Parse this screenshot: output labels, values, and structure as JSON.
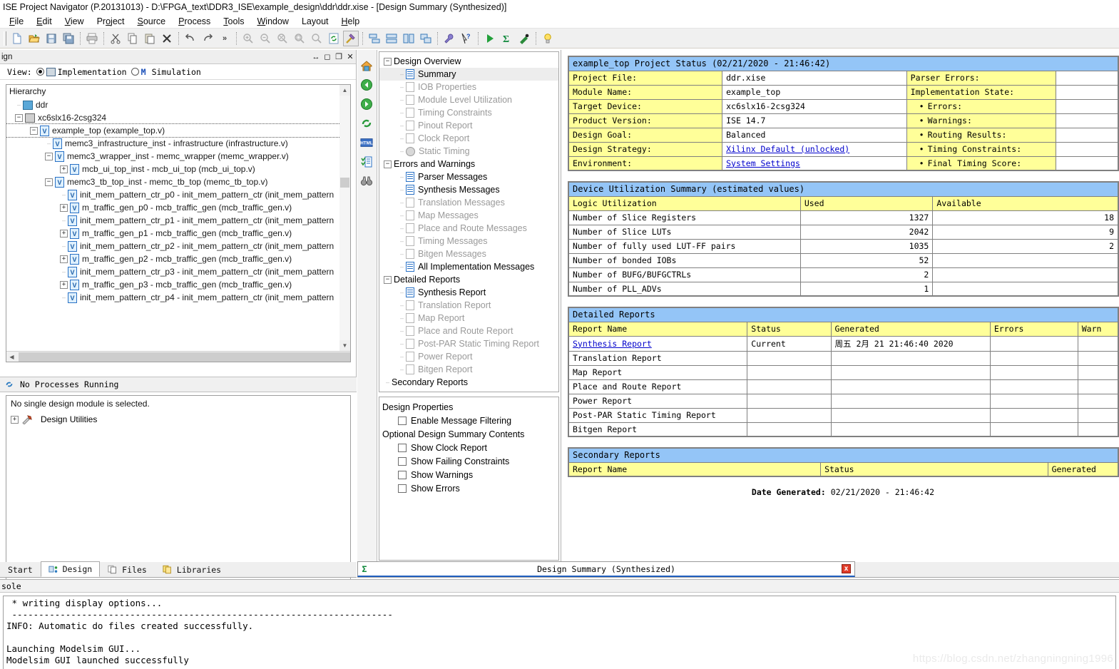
{
  "window": {
    "title": "ISE Project Navigator (P.20131013) - D:\\FPGA_text\\DDR3_ISE\\example_design\\ddr\\ddr.xise - [Design Summary (Synthesized)]"
  },
  "menu": [
    {
      "label": "File",
      "accel": "F"
    },
    {
      "label": "Edit",
      "accel": "E"
    },
    {
      "label": "View",
      "accel": "V"
    },
    {
      "label": "Project",
      "accel": "o"
    },
    {
      "label": "Source",
      "accel": "S"
    },
    {
      "label": "Process",
      "accel": "P"
    },
    {
      "label": "Tools",
      "accel": "T"
    },
    {
      "label": "Window",
      "accel": "W"
    },
    {
      "label": "Layout",
      "accel": ""
    },
    {
      "label": "Help",
      "accel": "H"
    }
  ],
  "toolbar": {
    "groups": [
      [
        "new-file-icon",
        "open-project-icon",
        "save-icon",
        "save-all-icon"
      ],
      [
        "print-icon"
      ],
      [
        "cut-icon",
        "copy-icon",
        "paste-icon",
        "delete-icon",
        "undo-icon",
        "redo-icon",
        "overflow-chevron-icon"
      ],
      [
        "zoom-in-icon",
        "zoom-out-icon",
        "zoom-fit-icon",
        "zoom-selection-icon",
        "zoom-area-icon",
        "refresh-icon",
        "implement-hammer-icon"
      ],
      [
        "tile-horizontally-icon",
        "tile-vertically-icon",
        "new-window-icon",
        "cascade-icon"
      ],
      [
        "options-wrench-icon",
        "whats-this-help-icon"
      ],
      [
        "run-icon",
        "design-summary-sigma-icon",
        "design-goals-icon"
      ],
      [
        "lightbulb-icon"
      ]
    ],
    "overflow_label": "»"
  },
  "design_panel": {
    "title": "ign",
    "controls": [
      "resize-icon",
      "maximize-icon",
      "float-icon",
      "close-icon"
    ],
    "view_label": "View:",
    "view_options": [
      {
        "label": "Implementation",
        "selected": true,
        "icon": "chip-icon"
      },
      {
        "label": "Simulation",
        "selected": false,
        "icon": "m-icon"
      }
    ],
    "hierarchy_label": "Hierarchy",
    "hierarchy": [
      {
        "depth": 0,
        "expander": "none",
        "icon": "project-icon",
        "label": "ddr"
      },
      {
        "depth": 0,
        "expander": "minus",
        "icon": "device-icon",
        "label": "xc6slx16-2csg324"
      },
      {
        "depth": 1,
        "expander": "minus",
        "icon": "verilog-top-icon",
        "label": "example_top (example_top.v)",
        "selected": true
      },
      {
        "depth": 2,
        "expander": "none",
        "icon": "verilog-icon",
        "label": "memc3_infrastructure_inst - infrastructure (infrastructure.v)"
      },
      {
        "depth": 2,
        "expander": "minus",
        "icon": "verilog-icon",
        "label": "memc3_wrapper_inst - memc_wrapper (memc_wrapper.v)"
      },
      {
        "depth": 3,
        "expander": "plus",
        "icon": "verilog-icon",
        "label": "mcb_ui_top_inst - mcb_ui_top (mcb_ui_top.v)"
      },
      {
        "depth": 2,
        "expander": "minus",
        "icon": "verilog-icon",
        "label": "memc3_tb_top_inst - memc_tb_top (memc_tb_top.v)"
      },
      {
        "depth": 3,
        "expander": "none",
        "icon": "verilog-icon",
        "label": "init_mem_pattern_ctr_p0 - init_mem_pattern_ctr (init_mem_pattern"
      },
      {
        "depth": 3,
        "expander": "plus",
        "icon": "verilog-icon",
        "label": "m_traffic_gen_p0 - mcb_traffic_gen (mcb_traffic_gen.v)"
      },
      {
        "depth": 3,
        "expander": "none",
        "icon": "verilog-icon",
        "label": "init_mem_pattern_ctr_p1 - init_mem_pattern_ctr (init_mem_pattern"
      },
      {
        "depth": 3,
        "expander": "plus",
        "icon": "verilog-icon",
        "label": "m_traffic_gen_p1 - mcb_traffic_gen (mcb_traffic_gen.v)"
      },
      {
        "depth": 3,
        "expander": "none",
        "icon": "verilog-icon",
        "label": "init_mem_pattern_ctr_p2 - init_mem_pattern_ctr (init_mem_pattern"
      },
      {
        "depth": 3,
        "expander": "plus",
        "icon": "verilog-icon",
        "label": "m_traffic_gen_p2 - mcb_traffic_gen (mcb_traffic_gen.v)"
      },
      {
        "depth": 3,
        "expander": "none",
        "icon": "verilog-icon",
        "label": "init_mem_pattern_ctr_p3 - init_mem_pattern_ctr (init_mem_pattern"
      },
      {
        "depth": 3,
        "expander": "plus",
        "icon": "verilog-icon",
        "label": "m_traffic_gen_p3 - mcb_traffic_gen (mcb_traffic_gen.v)"
      },
      {
        "depth": 3,
        "expander": "none",
        "icon": "verilog-icon",
        "label": "init_mem_pattern_ctr_p4 - init_mem_pattern_ctr (init_mem_pattern"
      }
    ]
  },
  "processes": {
    "header": "No Processes Running",
    "header_icon": "refresh-icon",
    "message": "No single design module is selected.",
    "items": [
      {
        "label": "Design Utilities",
        "expander": "plus",
        "icon": "utilities-icon"
      }
    ]
  },
  "left_tabs": [
    {
      "label": "Start",
      "icon": "",
      "active": false
    },
    {
      "label": "Design",
      "icon": "design-icon",
      "active": true
    },
    {
      "label": "Files",
      "icon": "files-icon",
      "active": false
    },
    {
      "label": "Libraries",
      "icon": "libraries-icon",
      "active": false
    }
  ],
  "icon_strip": [
    "home-icon",
    "back-arrow-icon",
    "forward-arrow-icon",
    "refresh-icon",
    "html-icon",
    "report-list-icon",
    "binoculars-icon"
  ],
  "overview_tree": [
    {
      "depth": 0,
      "expander": "minus",
      "icon": "",
      "label": "Design Overview",
      "state": "normal"
    },
    {
      "depth": 1,
      "expander": "none",
      "icon": "doc-active",
      "label": "Summary",
      "state": "selected"
    },
    {
      "depth": 1,
      "expander": "none",
      "icon": "doc",
      "label": "IOB Properties",
      "state": "disabled"
    },
    {
      "depth": 1,
      "expander": "none",
      "icon": "doc",
      "label": "Module Level Utilization",
      "state": "disabled"
    },
    {
      "depth": 1,
      "expander": "none",
      "icon": "doc",
      "label": "Timing Constraints",
      "state": "disabled"
    },
    {
      "depth": 1,
      "expander": "none",
      "icon": "doc",
      "label": "Pinout Report",
      "state": "disabled"
    },
    {
      "depth": 1,
      "expander": "none",
      "icon": "doc",
      "label": "Clock Report",
      "state": "disabled"
    },
    {
      "depth": 1,
      "expander": "none",
      "icon": "clock",
      "label": "Static Timing",
      "state": "disabled"
    },
    {
      "depth": 0,
      "expander": "minus",
      "icon": "",
      "label": "Errors and Warnings",
      "state": "normal"
    },
    {
      "depth": 1,
      "expander": "none",
      "icon": "doc-active",
      "label": "Parser Messages",
      "state": "normal"
    },
    {
      "depth": 1,
      "expander": "none",
      "icon": "doc-active",
      "label": "Synthesis Messages",
      "state": "normal"
    },
    {
      "depth": 1,
      "expander": "none",
      "icon": "doc",
      "label": "Translation Messages",
      "state": "disabled"
    },
    {
      "depth": 1,
      "expander": "none",
      "icon": "doc",
      "label": "Map Messages",
      "state": "disabled"
    },
    {
      "depth": 1,
      "expander": "none",
      "icon": "doc",
      "label": "Place and Route Messages",
      "state": "disabled"
    },
    {
      "depth": 1,
      "expander": "none",
      "icon": "doc",
      "label": "Timing Messages",
      "state": "disabled"
    },
    {
      "depth": 1,
      "expander": "none",
      "icon": "doc",
      "label": "Bitgen Messages",
      "state": "disabled"
    },
    {
      "depth": 1,
      "expander": "none",
      "icon": "doc-active",
      "label": "All Implementation Messages",
      "state": "normal"
    },
    {
      "depth": 0,
      "expander": "minus",
      "icon": "",
      "label": "Detailed Reports",
      "state": "normal"
    },
    {
      "depth": 1,
      "expander": "none",
      "icon": "doc-active",
      "label": "Synthesis Report",
      "state": "normal"
    },
    {
      "depth": 1,
      "expander": "none",
      "icon": "doc",
      "label": "Translation Report",
      "state": "disabled"
    },
    {
      "depth": 1,
      "expander": "none",
      "icon": "doc",
      "label": "Map Report",
      "state": "disabled"
    },
    {
      "depth": 1,
      "expander": "none",
      "icon": "doc",
      "label": "Place and Route Report",
      "state": "disabled"
    },
    {
      "depth": 1,
      "expander": "none",
      "icon": "doc",
      "label": "Post-PAR Static Timing Report",
      "state": "disabled"
    },
    {
      "depth": 1,
      "expander": "none",
      "icon": "doc",
      "label": "Power Report",
      "state": "disabled"
    },
    {
      "depth": 1,
      "expander": "none",
      "icon": "doc",
      "label": "Bitgen Report",
      "state": "disabled"
    },
    {
      "depth": 0,
      "expander": "none",
      "icon": "",
      "label": "Secondary Reports",
      "state": "normal"
    }
  ],
  "design_properties": {
    "section1_title": "Design Properties",
    "section1_items": [
      {
        "label": "Enable Message Filtering",
        "checked": false
      }
    ],
    "section2_title": "Optional Design Summary Contents",
    "section2_items": [
      {
        "label": "Show Clock Report",
        "checked": false
      },
      {
        "label": "Show Failing Constraints",
        "checked": false
      },
      {
        "label": "Show Warnings",
        "checked": false
      },
      {
        "label": "Show Errors",
        "checked": false
      }
    ]
  },
  "report": {
    "project_status": {
      "banner": "example_top Project Status (02/21/2020 - 21:46:42)",
      "rows": [
        {
          "label": "Project File:",
          "value": "ddr.xise",
          "link": false,
          "right": "Parser Errors:",
          "right_bullet": false
        },
        {
          "label": "Module Name:",
          "value": "example_top",
          "link": false,
          "right": "Implementation State:",
          "right_bullet": false
        },
        {
          "label": "Target Device:",
          "value": "xc6slx16-2csg324",
          "link": false,
          "right": "Errors:",
          "right_bullet": true
        },
        {
          "label": "Product Version:",
          "value": "ISE 14.7",
          "link": false,
          "right": "Warnings:",
          "right_bullet": true
        },
        {
          "label": "Design Goal:",
          "value": "Balanced",
          "link": false,
          "right": "Routing Results:",
          "right_bullet": true
        },
        {
          "label": "Design Strategy:",
          "value": "Xilinx Default (unlocked)",
          "link": true,
          "right": "Timing Constraints:",
          "right_bullet": true
        },
        {
          "label": "Environment:",
          "value": "System Settings",
          "link": true,
          "right": "Final Timing Score:",
          "right_bullet": true
        }
      ]
    },
    "device_utilization": {
      "banner": "Device Utilization Summary (estimated values)",
      "headers": [
        "Logic Utilization",
        "Used",
        "Available"
      ],
      "rows": [
        {
          "name": "Number of Slice Registers",
          "used": "1327",
          "available": "18"
        },
        {
          "name": "Number of Slice LUTs",
          "used": "2042",
          "available": "9"
        },
        {
          "name": "Number of fully used LUT-FF pairs",
          "used": "1035",
          "available": "2"
        },
        {
          "name": "Number of bonded IOBs",
          "used": "52",
          "available": ""
        },
        {
          "name": "Number of BUFG/BUFGCTRLs",
          "used": "2",
          "available": ""
        },
        {
          "name": "Number of PLL_ADVs",
          "used": "1",
          "available": ""
        }
      ]
    },
    "detailed_reports": {
      "banner": "Detailed Reports",
      "headers": [
        "Report Name",
        "Status",
        "Generated",
        "Errors",
        "Warn"
      ],
      "rows": [
        {
          "name": "Synthesis Report",
          "link": true,
          "status": "Current",
          "generated": "周五 2月 21 21:46:40 2020",
          "errors": "",
          "warnings": ""
        },
        {
          "name": "Translation Report",
          "link": false,
          "status": "",
          "generated": "",
          "errors": "",
          "warnings": ""
        },
        {
          "name": "Map Report",
          "link": false,
          "status": "",
          "generated": "",
          "errors": "",
          "warnings": ""
        },
        {
          "name": "Place and Route Report",
          "link": false,
          "status": "",
          "generated": "",
          "errors": "",
          "warnings": ""
        },
        {
          "name": "Power Report",
          "link": false,
          "status": "",
          "generated": "",
          "errors": "",
          "warnings": ""
        },
        {
          "name": "Post-PAR Static Timing Report",
          "link": false,
          "status": "",
          "generated": "",
          "errors": "",
          "warnings": ""
        },
        {
          "name": "Bitgen Report",
          "link": false,
          "status": "",
          "generated": "",
          "errors": "",
          "warnings": ""
        }
      ]
    },
    "secondary_reports": {
      "banner": "Secondary Reports",
      "headers": [
        "Report Name",
        "Status",
        "Generated"
      ]
    },
    "date_generated_label": "Date Generated:",
    "date_generated_value": "02/21/2020 - 21:46:42"
  },
  "doc_tab": {
    "icon": "design-summary-sigma-icon",
    "title": "Design Summary (Synthesized)",
    "close_label": "x"
  },
  "console": {
    "label": "sole",
    "text": " * writing display options...\n -----------------------------------------------------------------------\nINFO: Automatic do files created successfully.\n\nLaunching Modelsim GUI...\nModelsim GUI launched successfully"
  },
  "watermark": "https://blog.csdn.net/zhangningning1996",
  "colors": {
    "banner_blue": "#94c5f7",
    "header_yellow": "#ffff99",
    "link": "#0000cc",
    "verilog_icon": "#2a72c6"
  }
}
